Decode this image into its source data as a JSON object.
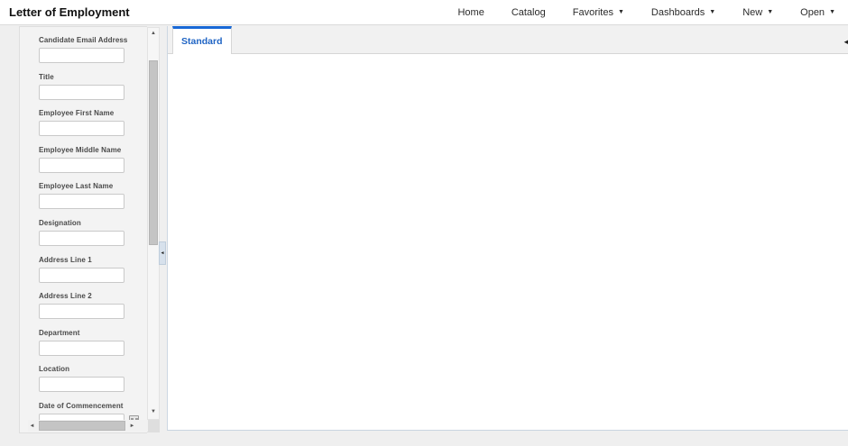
{
  "header": {
    "title": "Letter of Employment",
    "nav_items": [
      {
        "label": "Home",
        "has_dropdown": false
      },
      {
        "label": "Catalog",
        "has_dropdown": false
      },
      {
        "label": "Favorites",
        "has_dropdown": true
      },
      {
        "label": "Dashboards",
        "has_dropdown": true
      },
      {
        "label": "New",
        "has_dropdown": true
      },
      {
        "label": "Open",
        "has_dropdown": true
      }
    ],
    "dropdown_caret_glyph": "▼"
  },
  "parameters_panel": {
    "fields": [
      {
        "label": "Candidate Email Address",
        "value": "",
        "type": "text"
      },
      {
        "label": "Title",
        "value": "",
        "type": "text"
      },
      {
        "label": "Employee First Name",
        "value": "",
        "type": "text"
      },
      {
        "label": "Employee Middle Name",
        "value": "",
        "type": "text"
      },
      {
        "label": "Employee Last Name",
        "value": "",
        "type": "text"
      },
      {
        "label": "Designation",
        "value": "",
        "type": "text"
      },
      {
        "label": "Address Line 1",
        "value": "",
        "type": "text"
      },
      {
        "label": "Address Line 2",
        "value": "",
        "type": "text"
      },
      {
        "label": "Department",
        "value": "",
        "type": "text"
      },
      {
        "label": "Location",
        "value": "",
        "type": "text"
      },
      {
        "label": "Date of Commencement",
        "value": "",
        "type": "date"
      }
    ]
  },
  "report_area": {
    "tabs": [
      {
        "label": "Standard",
        "active": true
      }
    ]
  },
  "scrollbar_glyphs": {
    "up": "▲",
    "down": "▼",
    "left": "◄",
    "right": "►",
    "collapse_left": "◄"
  },
  "colors": {
    "tab_accent": "#1868d6",
    "tab_text": "#1f64c4",
    "panel_bg": "#f3f3f3",
    "page_bg": "#efefef",
    "header_bg": "#ffffff"
  }
}
